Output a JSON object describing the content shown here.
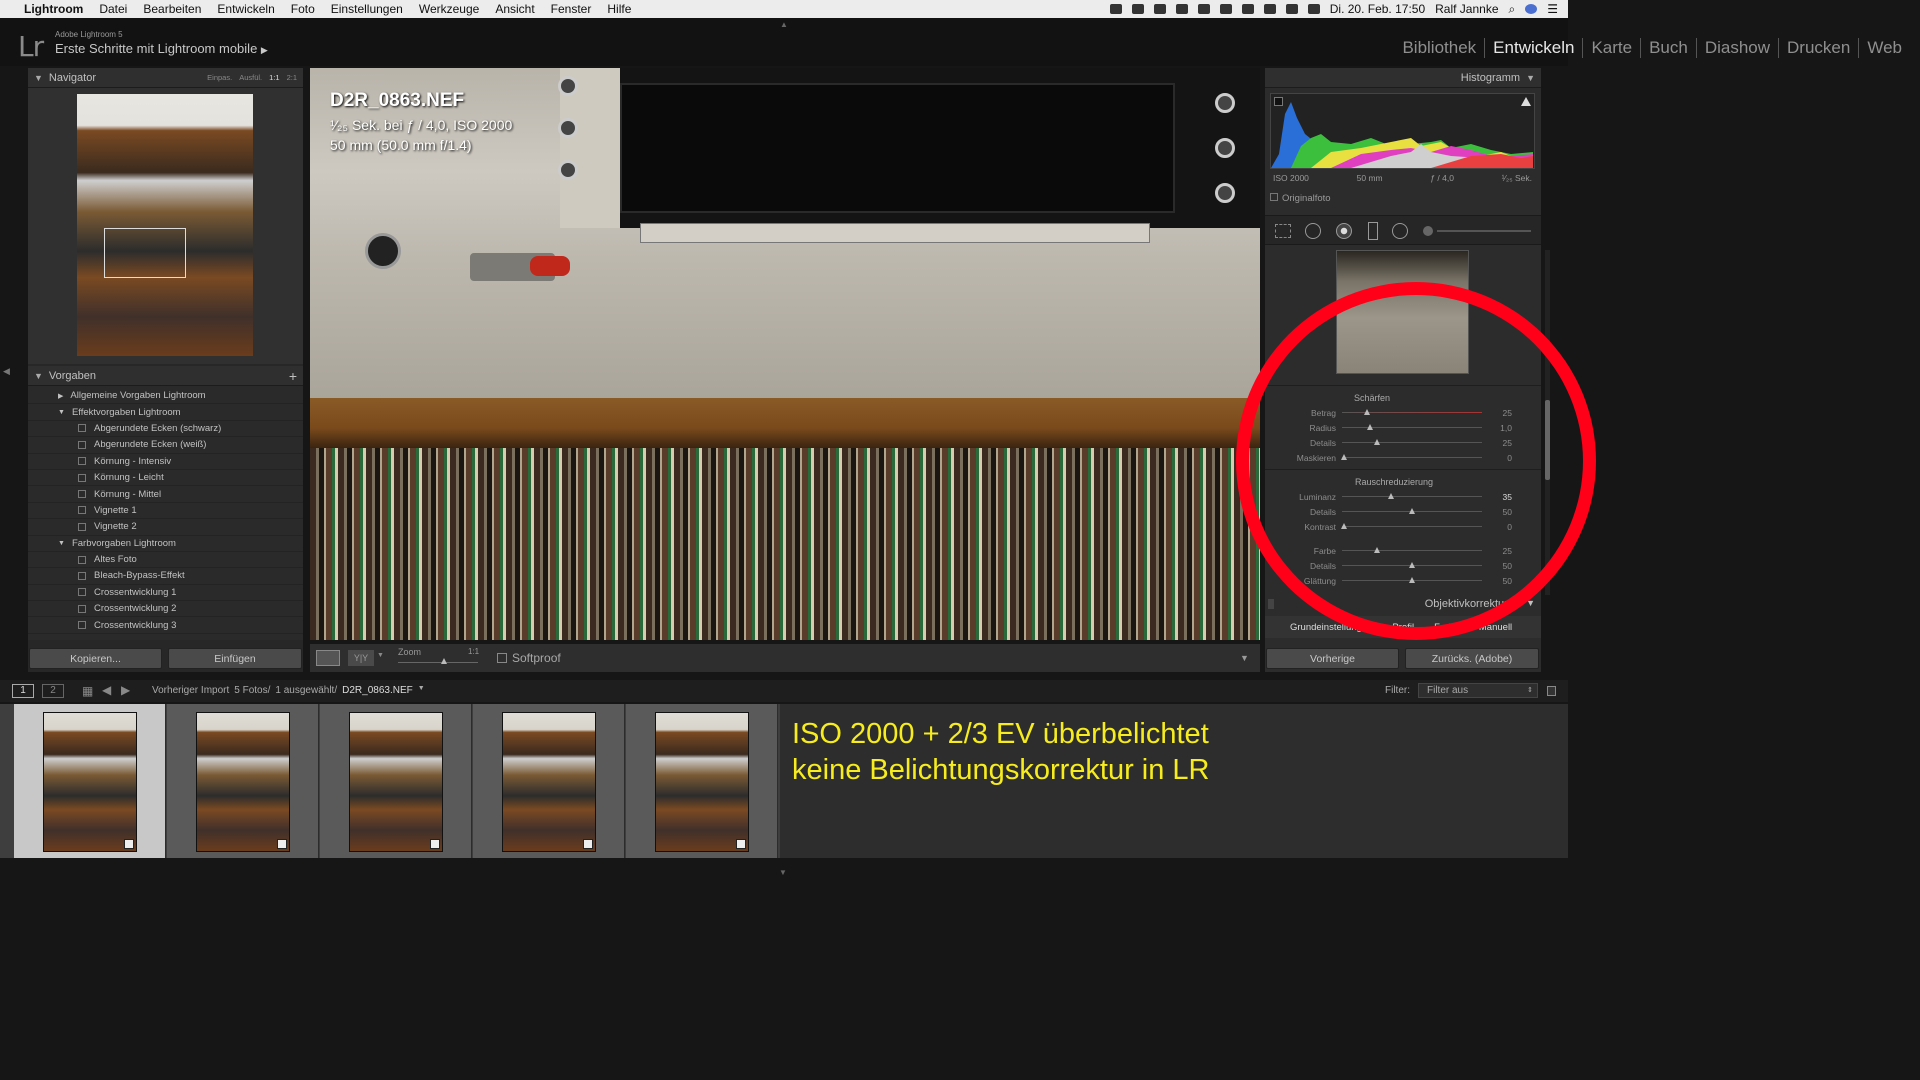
{
  "menubar": {
    "apple": "",
    "app_name": "Lightroom",
    "items": [
      "Datei",
      "Bearbeiten",
      "Entwickeln",
      "Foto",
      "Einstellungen",
      "Werkzeuge",
      "Ansicht",
      "Fenster",
      "Hilfe"
    ],
    "datetime": "Di. 20. Feb. 17:50",
    "user": "Ralf Jannke"
  },
  "identity": {
    "logo": "Lr",
    "product": "Adobe Lightroom 5",
    "title": "Erste Schritte mit Lightroom mobile"
  },
  "modules": [
    {
      "label": "Bibliothek",
      "active": false
    },
    {
      "label": "Entwickeln",
      "active": true
    },
    {
      "label": "Karte",
      "active": false
    },
    {
      "label": "Buch",
      "active": false
    },
    {
      "label": "Diashow",
      "active": false
    },
    {
      "label": "Drucken",
      "active": false
    },
    {
      "label": "Web",
      "active": false
    }
  ],
  "navigator": {
    "title": "Navigator",
    "zoom_options": [
      "Einpas.",
      "Ausfül.",
      "1:1",
      "2:1"
    ]
  },
  "presets": {
    "title": "Vorgaben",
    "add": "+",
    "items": [
      {
        "label": "Allgemeine Vorgaben Lightroom",
        "type": "folder-closed"
      },
      {
        "label": "Effektvorgaben Lightroom",
        "type": "folder-open"
      },
      {
        "label": "Abgerundete Ecken (schwarz)",
        "type": "preset"
      },
      {
        "label": "Abgerundete Ecken (weiß)",
        "type": "preset"
      },
      {
        "label": "Körnung - Intensiv",
        "type": "preset"
      },
      {
        "label": "Körnung - Leicht",
        "type": "preset"
      },
      {
        "label": "Körnung - Mittel",
        "type": "preset"
      },
      {
        "label": "Vignette 1",
        "type": "preset"
      },
      {
        "label": "Vignette 2",
        "type": "preset"
      },
      {
        "label": "Farbvorgaben Lightroom",
        "type": "folder-open"
      },
      {
        "label": "Altes Foto",
        "type": "preset"
      },
      {
        "label": "Bleach-Bypass-Effekt",
        "type": "preset"
      },
      {
        "label": "Crossentwicklung 1",
        "type": "preset"
      },
      {
        "label": "Crossentwicklung 2",
        "type": "preset"
      },
      {
        "label": "Crossentwicklung 3",
        "type": "preset"
      }
    ]
  },
  "left_buttons": {
    "copy": "Kopieren...",
    "paste": "Einfügen"
  },
  "image_info": {
    "filename": "D2R_0863.NEF",
    "line2": "¹⁄₂₅ Sek. bei ƒ / 4,0, ISO 2000",
    "line3": "50 mm (50.0 mm f/1.4)"
  },
  "toolbar": {
    "zoom_label": "Zoom",
    "zoom_value": "1:1",
    "softproof_label": "Softproof",
    "yy_label": "Y|Y"
  },
  "histogram": {
    "title": "Histogramm",
    "iso": "ISO 2000",
    "focal": "50 mm",
    "aperture": "ƒ / 4,0",
    "shutter": "¹⁄₂₅ Sek.",
    "original_label": "Originalfoto"
  },
  "sharpening": {
    "title": "Schärfen",
    "sliders": [
      {
        "label": "Betrag",
        "value": "25",
        "fraction": 0.17
      },
      {
        "label": "Radius",
        "value": "1,0",
        "fraction": 0.2
      },
      {
        "label": "Details",
        "value": "25",
        "fraction": 0.25
      },
      {
        "label": "Maskieren",
        "value": "0",
        "fraction": 0.0
      }
    ]
  },
  "noise": {
    "title": "Rauschreduzierung",
    "sliders": [
      {
        "label": "Luminanz",
        "value": "35",
        "fraction": 0.35
      },
      {
        "label": "Details",
        "value": "50",
        "fraction": 0.5
      },
      {
        "label": "Kontrast",
        "value": "0",
        "fraction": 0.0
      },
      {
        "label": "Farbe",
        "value": "25",
        "fraction": 0.25
      },
      {
        "label": "Details",
        "value": "50",
        "fraction": 0.5
      },
      {
        "label": "Glättung",
        "value": "50",
        "fraction": 0.5
      }
    ]
  },
  "lens": {
    "title": "Objektivkorrekturen",
    "tabs": [
      "Grundeinstellungen",
      "Profil",
      "Farbe",
      "Manuell"
    ]
  },
  "right_buttons": {
    "previous": "Vorherige",
    "reset": "Zurücks. (Adobe)"
  },
  "filmstrip_bar": {
    "view1": "1",
    "view2": "2",
    "source": "Vorheriger Import",
    "count": "5 Fotos/",
    "selected": "1 ausgewählt/",
    "file": "D2R_0863.NEF",
    "filter_label": "Filter:",
    "filter_value": "Filter aus"
  },
  "filmstrip": {
    "thumbnails": 5,
    "selected_index": 0
  },
  "annotation": {
    "line1": "ISO 2000 + 2/3 EV überbelichtet",
    "line2": "keine Belichtungskorrektur in LR"
  },
  "colors": {
    "annotation": "#f6ec1e",
    "highlight_circle": "#ff0018",
    "active_module": "#e8e8e8"
  }
}
